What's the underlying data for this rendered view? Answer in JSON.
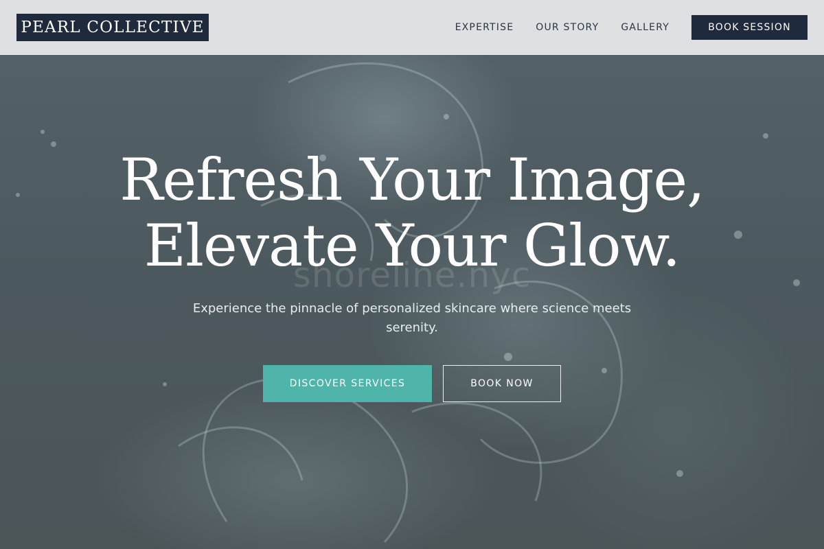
{
  "header": {
    "brand": "PEARL COLLECTIVE",
    "nav": [
      {
        "label": "EXPERTISE"
      },
      {
        "label": "OUR STORY"
      },
      {
        "label": "GALLERY"
      }
    ],
    "cta_label": "BOOK SESSION"
  },
  "hero": {
    "title_line1": "Refresh Your Image,",
    "title_line2": "Elevate Your Glow.",
    "subtitle": "Experience the pinnacle of personalized skincare where science meets serenity.",
    "primary_button": "DISCOVER SERVICES",
    "secondary_button": "BOOK NOW"
  },
  "watermark": "shoreline.nyc",
  "colors": {
    "brand_navy": "#1f2a3c",
    "accent_teal": "#4fb5ab",
    "header_bg": "#e8eaec"
  }
}
